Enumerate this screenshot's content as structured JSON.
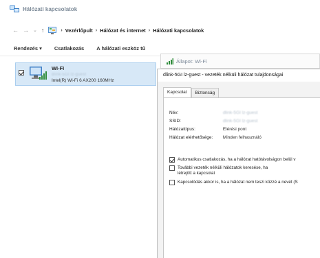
{
  "window": {
    "title": "Hálózati kapcsolatok"
  },
  "breadcrumb": [
    "Vezérlőpult",
    "Hálózat és internet",
    "Hálózati kapcsolatok"
  ],
  "toolbar": {
    "organize": "Rendezés",
    "organize_arrow": "▾",
    "connect": "Csatlakozás",
    "diagnose": "A hálózati eszköz tű"
  },
  "adapter": {
    "name": "Wi-Fi",
    "network_blur": "dlink-5GI lz-guest",
    "device": "Intel(R) Wi-Fi 6 AX200 160MHz",
    "checked": true
  },
  "status_window": {
    "title": "Állapot: Wi-Fi"
  },
  "dialog": {
    "title": "dlink-5GI lz-guest - vezeték nélküli hálózat tulajdonságai",
    "tabs": [
      "Kapcsolat",
      "Biztonság"
    ],
    "fields": {
      "name_label": "Név:",
      "name_value": "dlink-5GI lz-guest",
      "ssid_label": "SSID:",
      "ssid_value": "dlink-5GI lz-guest",
      "type_label": "Hálózattípus:",
      "type_value": "Elérési pont",
      "avail_label": "Hálózat elérhetősége:",
      "avail_value": "Minden felhasználó"
    },
    "options": [
      {
        "label": "Automatikus csatlakozás, ha a hálózat hatótávolságon belül v",
        "checked": true
      },
      {
        "label": "További vezeték nélküli hálózatok keresése, ha létrejött a kapcsolat",
        "checked": false
      },
      {
        "label": "Kapcsolódás akkor is, ha a hálózat nem teszi közzé a nevét (S",
        "checked": false
      }
    ]
  }
}
